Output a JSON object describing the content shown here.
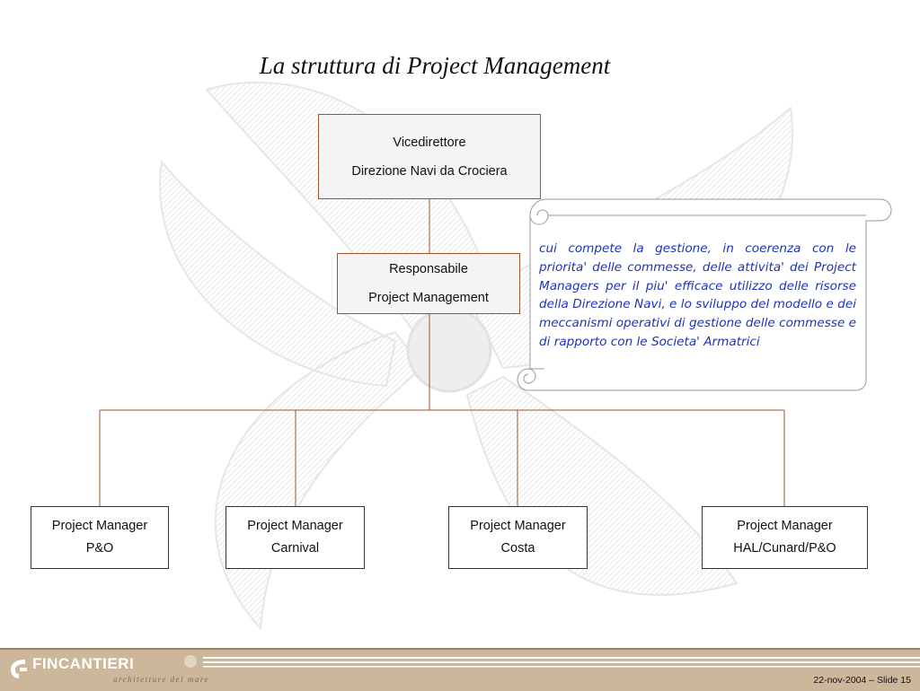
{
  "title": "La struttura di Project Management",
  "boxes": {
    "vice": {
      "line1": "Vicedirettore",
      "line2": "Direzione Navi da Crociera"
    },
    "resp": {
      "line1": "Responsabile",
      "line2": "Project Management"
    }
  },
  "managers": [
    {
      "line1": "Project Manager",
      "line2": "P&O"
    },
    {
      "line1": "Project Manager",
      "line2": "Carnival"
    },
    {
      "line1": "Project Manager",
      "line2": "Costa"
    },
    {
      "line1": "Project Manager",
      "line2": "HAL/Cunard/P&O"
    }
  ],
  "note": "cui compete la gestione, in coerenza con le priorita' delle commesse, delle attivita' dei Project Managers per il piu' efficace utilizzo delle risorse della Direzione Navi, e lo sviluppo del modello e dei meccanismi operativi di gestione delle commesse e di rapporto con le Societa' Armatrici",
  "footer": {
    "brand": "FINCANTIERI",
    "tagline": "architetture del mare",
    "slide_info": "22-nov-2004 – Slide 15"
  },
  "colors": {
    "connector": "#a0522d",
    "note_text": "#1f33b8",
    "footer_band": "#cdb79a"
  }
}
